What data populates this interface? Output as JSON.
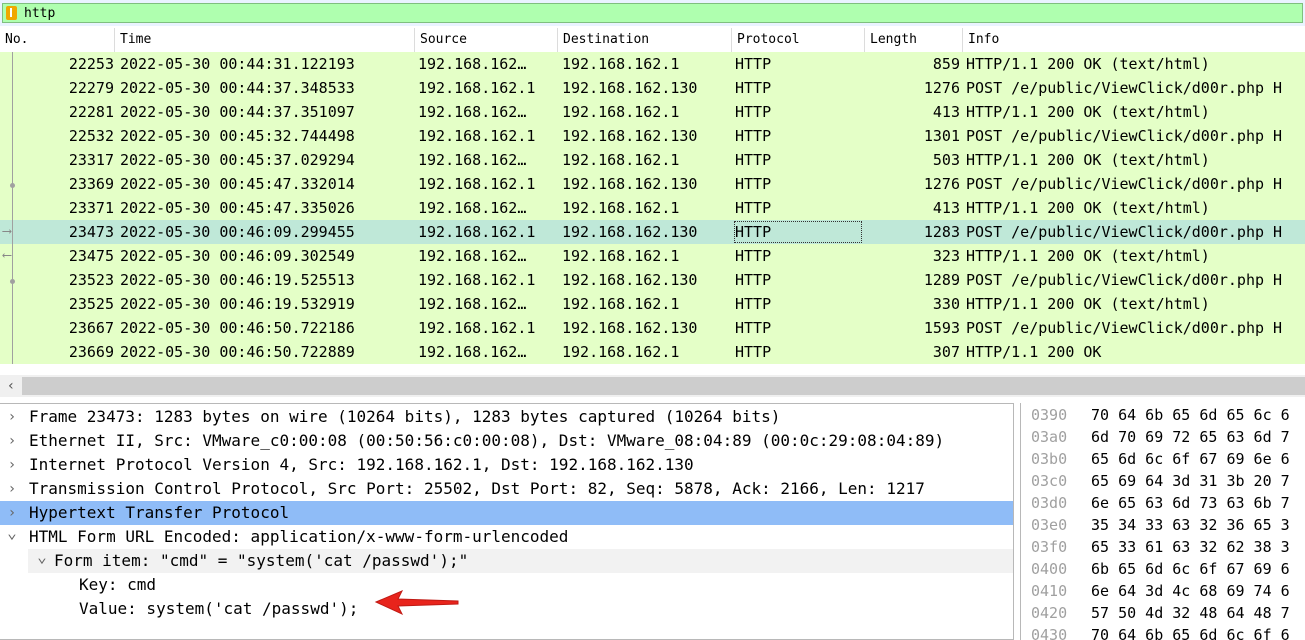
{
  "filter": {
    "value": "http"
  },
  "columns": [
    "No.",
    "Time",
    "Source",
    "Destination",
    "Protocol",
    "Length",
    "Info"
  ],
  "packets": [
    {
      "no": "22253",
      "time": "2022-05-30 00:44:31.122193",
      "src": "192.168.162…",
      "dst": "192.168.162.1",
      "proto": "HTTP",
      "len": "859",
      "info": "HTTP/1.1 200 OK  (text/html)"
    },
    {
      "no": "22279",
      "time": "2022-05-30 00:44:37.348533",
      "src": "192.168.162.1",
      "dst": "192.168.162.130",
      "proto": "HTTP",
      "len": "1276",
      "info": "POST /e/public/ViewClick/d00r.php H"
    },
    {
      "no": "22281",
      "time": "2022-05-30 00:44:37.351097",
      "src": "192.168.162…",
      "dst": "192.168.162.1",
      "proto": "HTTP",
      "len": "413",
      "info": "HTTP/1.1 200 OK  (text/html)"
    },
    {
      "no": "22532",
      "time": "2022-05-30 00:45:32.744498",
      "src": "192.168.162.1",
      "dst": "192.168.162.130",
      "proto": "HTTP",
      "len": "1301",
      "info": "POST /e/public/ViewClick/d00r.php H"
    },
    {
      "no": "23317",
      "time": "2022-05-30 00:45:37.029294",
      "src": "192.168.162…",
      "dst": "192.168.162.1",
      "proto": "HTTP",
      "len": "503",
      "info": "HTTP/1.1 200 OK  (text/html)"
    },
    {
      "no": "23369",
      "time": "2022-05-30 00:45:47.332014",
      "src": "192.168.162.1",
      "dst": "192.168.162.130",
      "proto": "HTTP",
      "len": "1276",
      "info": "POST /e/public/ViewClick/d00r.php H"
    },
    {
      "no": "23371",
      "time": "2022-05-30 00:45:47.335026",
      "src": "192.168.162…",
      "dst": "192.168.162.1",
      "proto": "HTTP",
      "len": "413",
      "info": "HTTP/1.1 200 OK  (text/html)"
    },
    {
      "no": "23473",
      "time": "2022-05-30 00:46:09.299455",
      "src": "192.168.162.1",
      "dst": "192.168.162.130",
      "proto": "HTTP",
      "len": "1283",
      "info": "POST /e/public/ViewClick/d00r.php H",
      "selected": true
    },
    {
      "no": "23475",
      "time": "2022-05-30 00:46:09.302549",
      "src": "192.168.162…",
      "dst": "192.168.162.1",
      "proto": "HTTP",
      "len": "323",
      "info": "HTTP/1.1 200 OK  (text/html)"
    },
    {
      "no": "23523",
      "time": "2022-05-30 00:46:19.525513",
      "src": "192.168.162.1",
      "dst": "192.168.162.130",
      "proto": "HTTP",
      "len": "1289",
      "info": "POST /e/public/ViewClick/d00r.php H"
    },
    {
      "no": "23525",
      "time": "2022-05-30 00:46:19.532919",
      "src": "192.168.162…",
      "dst": "192.168.162.1",
      "proto": "HTTP",
      "len": "330",
      "info": "HTTP/1.1 200 OK  (text/html)"
    },
    {
      "no": "23667",
      "time": "2022-05-30 00:46:50.722186",
      "src": "192.168.162.1",
      "dst": "192.168.162.130",
      "proto": "HTTP",
      "len": "1593",
      "info": "POST /e/public/ViewClick/d00r.php H"
    },
    {
      "no": "23669",
      "time": "2022-05-30 00:46:50.722889",
      "src": "192.168.162…",
      "dst": "192.168.162.1",
      "proto": "HTTP",
      "len": "307",
      "info": "HTTP/1.1 200 OK"
    }
  ],
  "details": [
    {
      "text": "Frame 23473: 1283 bytes on wire (10264 bits), 1283 bytes captured (10264 bits)",
      "expander": "collapsed",
      "indent": 0
    },
    {
      "text": "Ethernet II, Src: VMware_c0:00:08 (00:50:56:c0:00:08), Dst: VMware_08:04:89 (00:0c:29:08:04:89)",
      "expander": "collapsed",
      "indent": 0
    },
    {
      "text": "Internet Protocol Version 4, Src: 192.168.162.1, Dst: 192.168.162.130",
      "expander": "collapsed",
      "indent": 0
    },
    {
      "text": "Transmission Control Protocol, Src Port: 25502, Dst Port: 82, Seq: 5878, Ack: 2166, Len: 1217",
      "expander": "collapsed",
      "indent": 0
    },
    {
      "text": "Hypertext Transfer Protocol",
      "expander": "collapsed",
      "indent": 0,
      "selected": true
    },
    {
      "text": "HTML Form URL Encoded: application/x-www-form-urlencoded",
      "expander": "expanded",
      "indent": 0
    },
    {
      "text": "Form item: \"cmd\" = \"system('cat /passwd');\"",
      "expander": "expanded",
      "indent": 1,
      "sub": true
    },
    {
      "text": "Key: cmd",
      "expander": "none",
      "indent": 2
    },
    {
      "text": "Value: system('cat /passwd');",
      "expander": "none",
      "indent": 2
    }
  ],
  "hex": [
    {
      "offset": "0390",
      "bytes": "70 64 6b 65 6d 65 6c 6"
    },
    {
      "offset": "03a0",
      "bytes": "6d 70 69 72 65 63 6d 7"
    },
    {
      "offset": "03b0",
      "bytes": "65 6d 6c 6f 67 69 6e 6"
    },
    {
      "offset": "03c0",
      "bytes": "65 69 64 3d 31 3b 20 7"
    },
    {
      "offset": "03d0",
      "bytes": "6e 65 63 6d 73 63 6b 7"
    },
    {
      "offset": "03e0",
      "bytes": "35 34 33 63 32 36 65 3"
    },
    {
      "offset": "03f0",
      "bytes": "65 33 61 63 32 62 38 3"
    },
    {
      "offset": "0400",
      "bytes": "6b 65 6d 6c 6f 67 69 6"
    },
    {
      "offset": "0410",
      "bytes": "6e 64 3d 4c 68 69 74 6"
    },
    {
      "offset": "0420",
      "bytes": "57 50 4d 32 48 64 48 7"
    },
    {
      "offset": "0430",
      "bytes": "70 64 6b 65 6d 6c 6f 6"
    }
  ],
  "colors": {
    "filter_bg": "#afffaf",
    "row_http": "#e4ffc7",
    "row_selected": "#bfe8d8",
    "detail_selected": "#8fbcf7",
    "annotation_arrow": "#e8241c"
  }
}
